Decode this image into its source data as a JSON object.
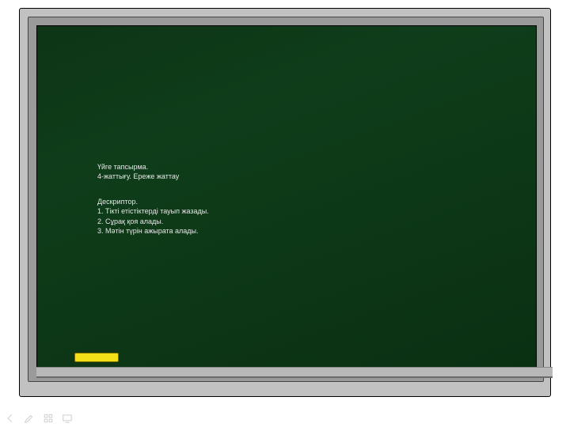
{
  "homework": {
    "title": "Үйге тапсырма.",
    "line": "4-жаттығу. Ереже жаттау"
  },
  "descriptor": {
    "title": "Дескриптор.",
    "items": [
      "1. Тікті етістіктерді тауып жазады.",
      "2. Сұрақ қоя алады.",
      "3. Мәтін түрін ажырата алады."
    ]
  }
}
